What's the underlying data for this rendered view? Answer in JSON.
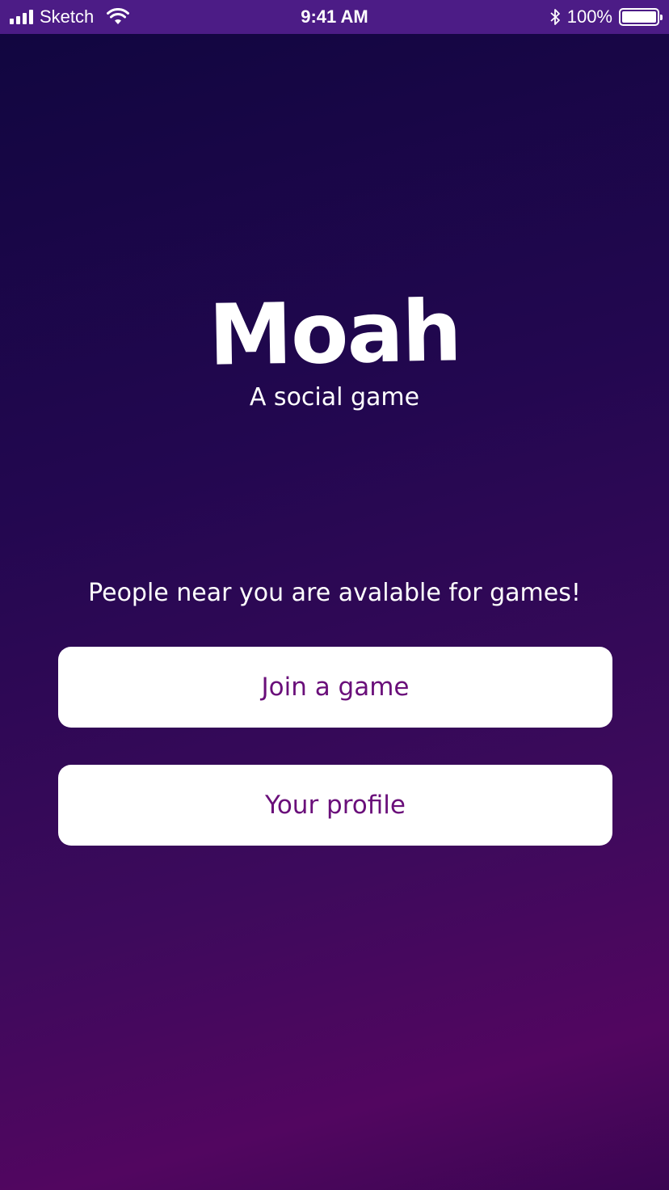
{
  "status_bar": {
    "carrier": "Sketch",
    "time": "9:41 AM",
    "battery": "100%",
    "icons": [
      "signal-icon",
      "wifi-icon",
      "bluetooth-icon",
      "battery-icon"
    ]
  },
  "app": {
    "title": "Moah",
    "tagline": "A social game"
  },
  "main": {
    "prompt": "People near you are avalable for games!",
    "join_label": "Join a game",
    "profile_label": "Your profile"
  },
  "colors": {
    "status_bar_bg": "#4c1c86",
    "background_top": "#10063f",
    "background_bottom": "#520660",
    "button_bg": "#ffffff",
    "button_text": "#6a0f7a"
  }
}
